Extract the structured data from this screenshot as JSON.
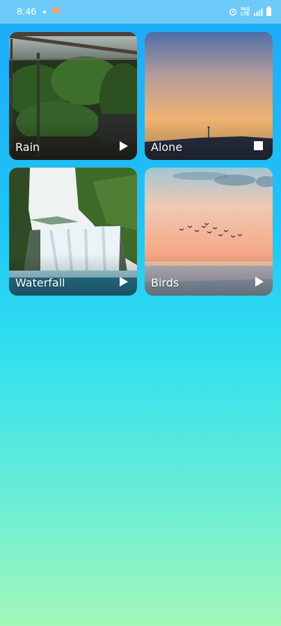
{
  "status_bar": {
    "time": "8:46",
    "network_top": "Vo))",
    "network_bottom": "LTE",
    "icons": [
      "notification-dot-icon",
      "heart-icon",
      "alarm-icon",
      "signal-icon",
      "battery-icon"
    ]
  },
  "sounds": [
    {
      "label": "Rain",
      "state": "play",
      "control_icon": "play-icon"
    },
    {
      "label": "Alone",
      "state": "stop",
      "control_icon": "stop-icon"
    },
    {
      "label": "Waterfall",
      "state": "play",
      "control_icon": "play-icon"
    },
    {
      "label": "Birds",
      "state": "play",
      "control_icon": "play-icon"
    }
  ],
  "colors": {
    "status_bar": "#6ecaf8",
    "gradient_top": "#1ea8f9",
    "gradient_bottom": "#a3f7b9",
    "text": "#ffffff"
  }
}
